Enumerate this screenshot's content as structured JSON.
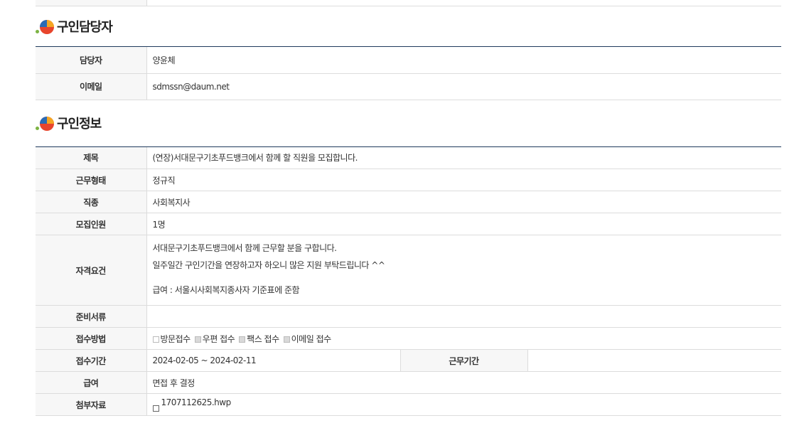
{
  "manager_section": {
    "title": "구인담당자",
    "rows": [
      {
        "label": "담당자",
        "value": "양윤체"
      },
      {
        "label": "이메일",
        "value": "sdmssn@daum.net"
      }
    ]
  },
  "job_section": {
    "title": "구인정보",
    "subject": {
      "label": "제목",
      "value": "(연장)서대문구기초푸드뱅크에서 함께 할 직원을 모집합니다."
    },
    "work_type": {
      "label": "근무형태",
      "value": "정규직"
    },
    "job_kind": {
      "label": "직종",
      "value": "사회복지사"
    },
    "headcount": {
      "label": "모집인원",
      "value": "1명"
    },
    "qualification": {
      "label": "자격요건",
      "line1": "서대문구기초푸드뱅크에서 함께 근무할 분을 구합니다.",
      "line2": "일주일간 구인기간을 연장하고자 하오니 많은 지원 부탁드립니다 ^^",
      "line3": "",
      "line4": "급여 : 서울시사회복지종사자 기준표에 준함"
    },
    "documents": {
      "label": "준비서류",
      "value": ""
    },
    "apply_method": {
      "label": "접수방법",
      "options": [
        {
          "label": "방문접수",
          "checked": false
        },
        {
          "label": "우편 접수",
          "checked": true
        },
        {
          "label": "팩스 접수",
          "checked": true
        },
        {
          "label": "이메일 접수",
          "checked": true
        }
      ]
    },
    "apply_period": {
      "label": "접수기간",
      "value": "2024-02-05 ~ 2024-02-11"
    },
    "work_period": {
      "label": "근무기간",
      "value": ""
    },
    "salary": {
      "label": "급여",
      "value": "면접 후 결정"
    },
    "attachment": {
      "label": "첨부자료",
      "file": "1707112625.hwp"
    }
  },
  "colors": {
    "header_bg": "#f7f7f7",
    "border": "#dcdcdc",
    "title_line": "#1f3a5c"
  }
}
